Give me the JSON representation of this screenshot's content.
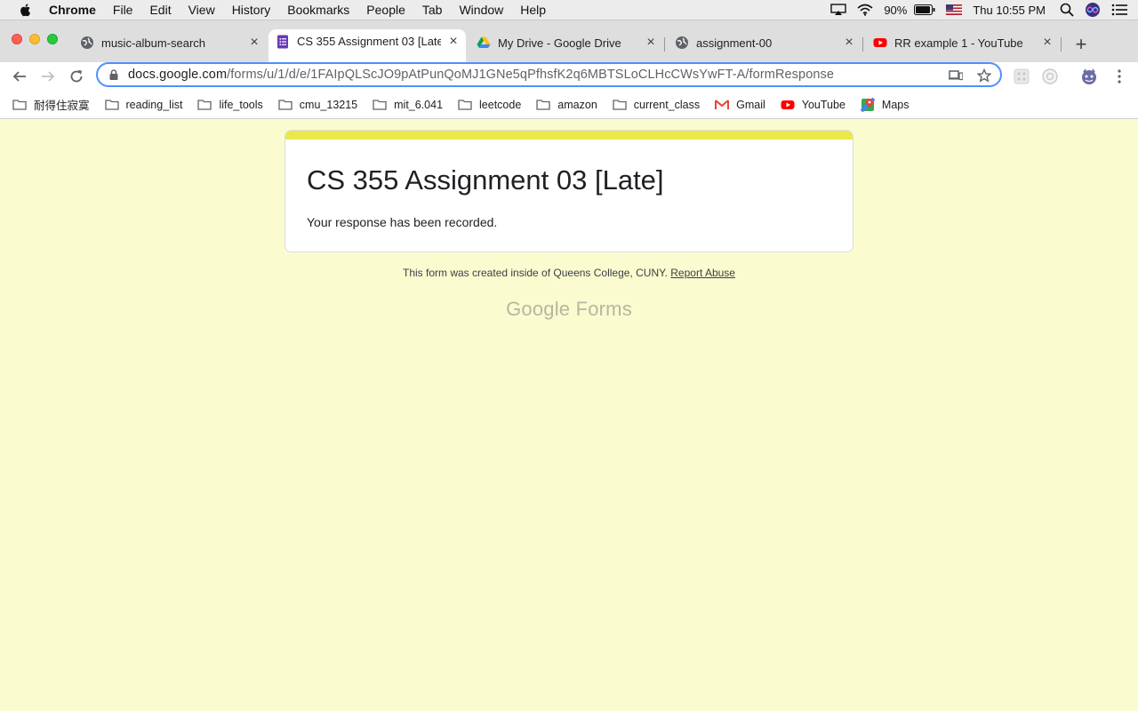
{
  "menubar": {
    "app": "Chrome",
    "items": [
      "File",
      "Edit",
      "View",
      "History",
      "Bookmarks",
      "People",
      "Tab",
      "Window",
      "Help"
    ],
    "battery": "90%",
    "clock": "Thu 10:55 PM"
  },
  "tabs": [
    {
      "title": "music-album-search",
      "icon": "globe-icon"
    },
    {
      "title": "CS 355 Assignment 03 [Late]",
      "icon": "google-forms-icon",
      "active": true
    },
    {
      "title": "My Drive - Google Drive",
      "icon": "google-drive-icon"
    },
    {
      "title": "assignment-00",
      "icon": "globe-icon"
    },
    {
      "title": "RR example 1 - YouTube",
      "icon": "youtube-icon"
    }
  ],
  "address": {
    "host": "docs.google.com",
    "path": "/forms/u/1/d/e/1FAIpQLScJO9pAtPunQoMJ1GNe5qPfhsfK2q6MBTSLoCLHcCWsYwFT-A/formResponse"
  },
  "bookmarks": [
    {
      "label": "耐得住寂寞",
      "icon": "folder-icon"
    },
    {
      "label": "reading_list",
      "icon": "folder-icon"
    },
    {
      "label": "life_tools",
      "icon": "folder-icon"
    },
    {
      "label": "cmu_13215",
      "icon": "folder-icon"
    },
    {
      "label": "mit_6.041",
      "icon": "folder-icon"
    },
    {
      "label": "leetcode",
      "icon": "folder-icon"
    },
    {
      "label": "amazon",
      "icon": "folder-icon"
    },
    {
      "label": "current_class",
      "icon": "folder-icon"
    },
    {
      "label": "Gmail",
      "icon": "gmail-icon"
    },
    {
      "label": "YouTube",
      "icon": "youtube-icon"
    },
    {
      "label": "Maps",
      "icon": "maps-icon"
    }
  ],
  "form": {
    "title": "CS 355 Assignment 03 [Late]",
    "message": "Your response has been recorded.",
    "footer_note": "This form was created inside of Queens College, CUNY.",
    "report_link": "Report Abuse",
    "logo_google": "Google",
    "logo_forms": "Forms"
  },
  "colors": {
    "page_background": "#fbfbd0",
    "card_accent": "#ebe84a",
    "omnibox_focus": "#4d90fe"
  }
}
